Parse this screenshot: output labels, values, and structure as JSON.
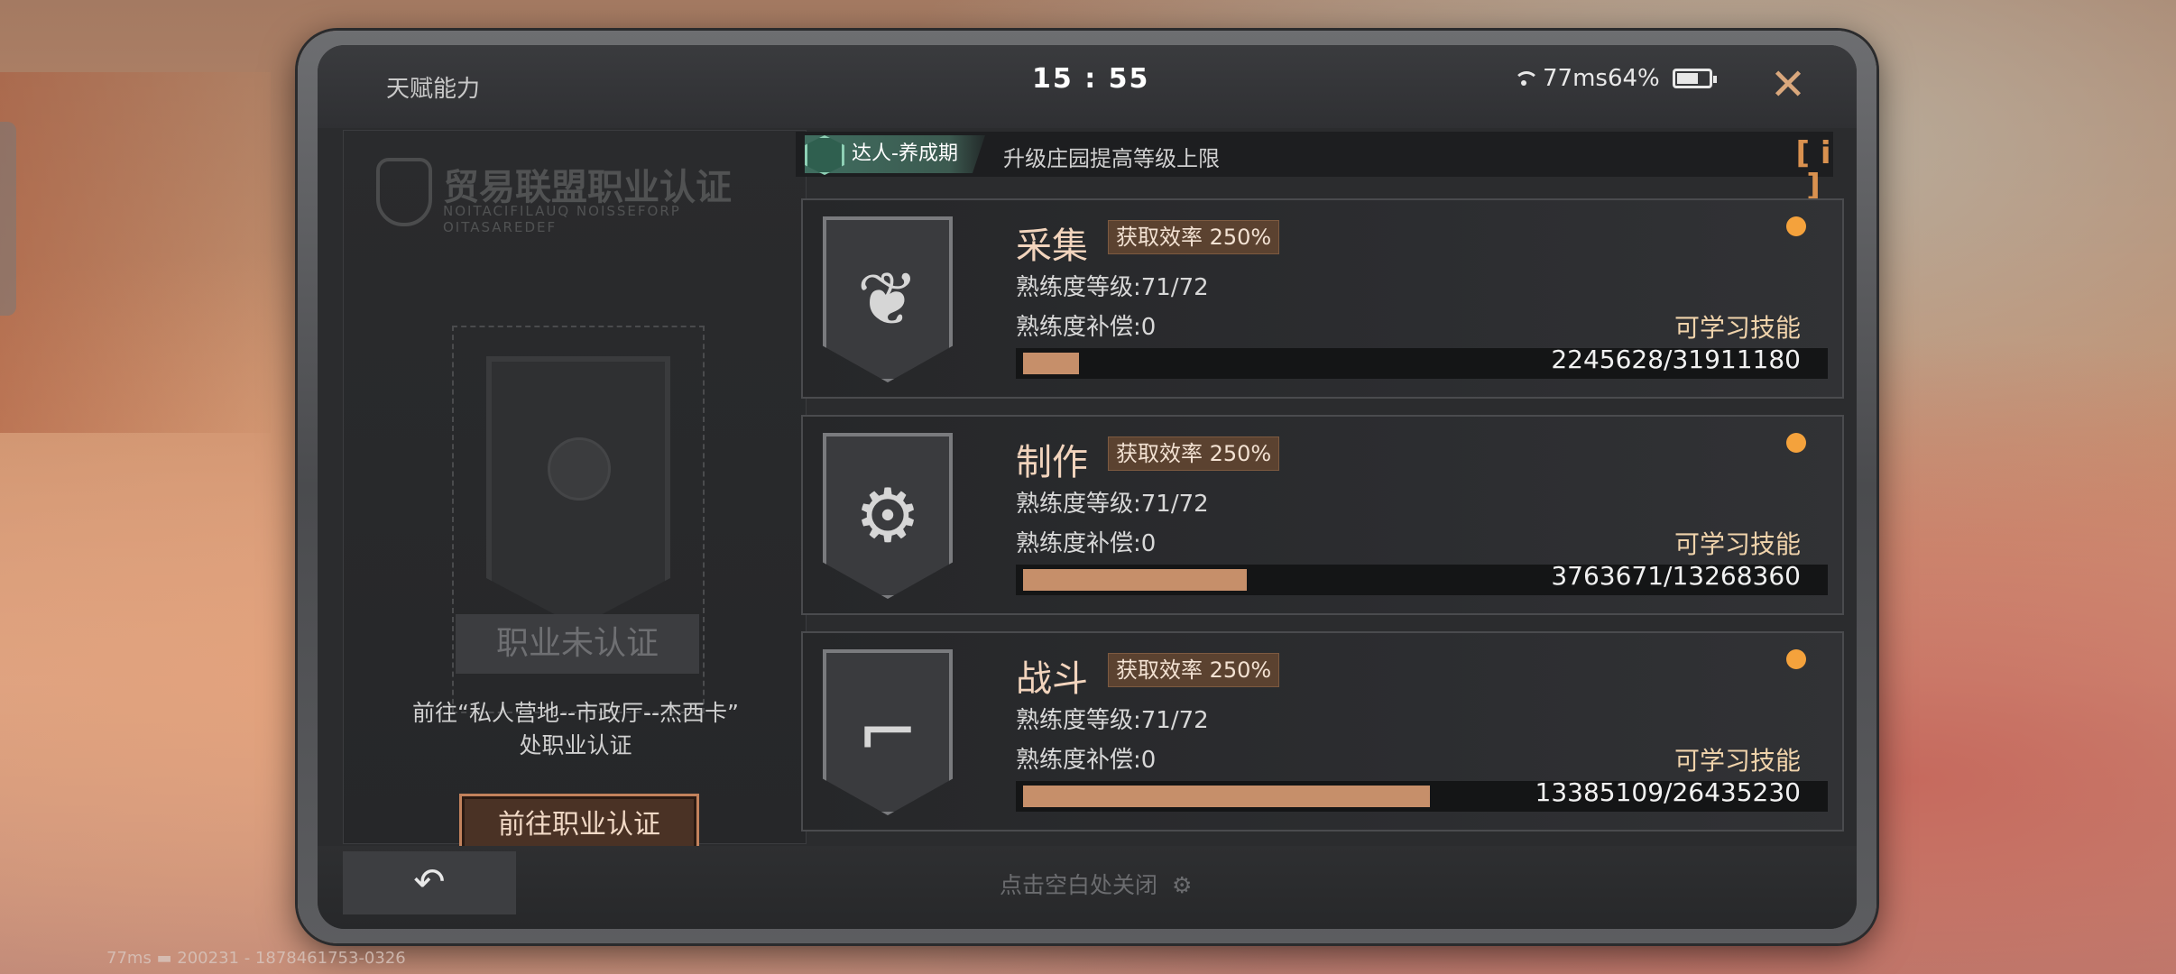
{
  "window": {
    "title": "天赋能力",
    "clock": "15 : 55",
    "status_text": "77ms64%",
    "close_icon": "close-icon"
  },
  "left": {
    "cert_title": "贸易联盟职业认证",
    "cert_subtitle": "NOITACIFILAUQ NOISSEFORP OITASAREDEF",
    "cert_status": "职业未认证",
    "guide_line1": "前往“私人营地--市政厅--杰西卡”",
    "guide_line2": "处职业认证",
    "cert_button": "前往职业认证"
  },
  "period": {
    "tag": "达人-养成期",
    "description": "升级庄园提高等级上限",
    "info_label": "[ i ]"
  },
  "skills": [
    {
      "name": "采集",
      "efficiency": "获取效率 250%",
      "level": "熟练度等级:71/72",
      "compensation": "熟练度补偿:0",
      "learn": "可学习技能",
      "progress_text": "2245628/31911180",
      "progress": 0.07,
      "icon": "herb-icon"
    },
    {
      "name": "制作",
      "efficiency": "获取效率 250%",
      "level": "熟练度等级:71/72",
      "compensation": "熟练度补偿:0",
      "learn": "可学习技能",
      "progress_text": "3763671/13268360",
      "progress": 0.28,
      "icon": "hammer-gear-icon"
    },
    {
      "name": "战斗",
      "efficiency": "获取效率 250%",
      "level": "熟练度等级:71/72",
      "compensation": "熟练度补偿:0",
      "learn": "可学习技能",
      "progress_text": "13385109/26435230",
      "progress": 0.51,
      "icon": "gun-icon"
    }
  ],
  "bottom": {
    "hint": "点击空白处关闭",
    "status_line": "77ms ▬ 200231 - 1878461753-0326"
  },
  "colors": {
    "accent_orange": "#f4a23c",
    "progress_fill": "#c68f6a",
    "period_green": "#3f6d5f",
    "button_border": "#c2825c"
  }
}
